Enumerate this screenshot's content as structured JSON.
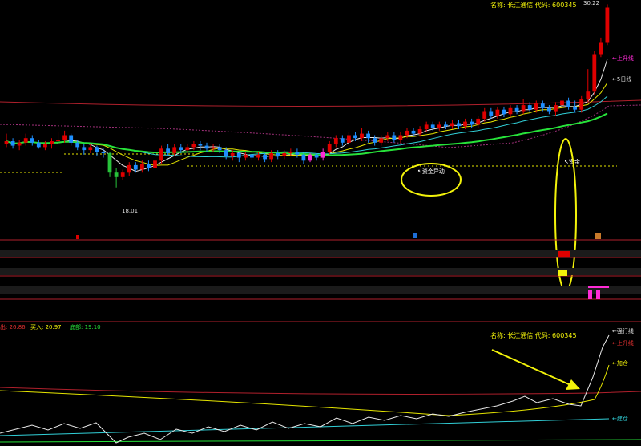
{
  "stock": {
    "name_label": "名称: 长江通信 代码: 600345",
    "name_label_lower": "名称: 长江通信 代码: 600345"
  },
  "colors": {
    "up": "#e00000",
    "down": "#1e8fff",
    "pink": "#ff2bd6",
    "green_line": "#27e33a",
    "yellow": "#e6e600",
    "red_line": "#b0202c",
    "cyan": "#31d0d8",
    "white": "#e8e8e8",
    "annot": "#f2f20a"
  },
  "chart_data": [
    {
      "type": "candlestick",
      "price_high_label": "30.22",
      "price_low_label": "18.01",
      "ylim": [
        16.5,
        30.4
      ],
      "x_count": 94,
      "candles": [
        [
          20.9,
          21.1,
          21.6,
          20.7
        ],
        [
          21.1,
          20.8,
          21.3,
          20.6
        ],
        [
          20.8,
          21.0,
          21.2,
          20.5
        ],
        [
          21.0,
          21.3,
          21.6,
          20.8
        ],
        [
          21.3,
          21.0,
          21.5,
          20.8
        ],
        [
          21.0,
          20.7,
          21.2,
          20.6
        ],
        [
          20.7,
          20.9,
          21.1,
          20.5
        ],
        [
          20.9,
          21.1,
          21.3,
          20.6
        ],
        [
          21.1,
          21.2,
          21.7,
          20.9
        ],
        [
          21.2,
          21.5,
          21.8,
          21.0
        ],
        [
          21.5,
          21.0,
          21.6,
          20.8
        ],
        [
          21.0,
          20.7,
          21.2,
          20.5
        ],
        [
          20.7,
          20.5,
          20.9,
          20.2
        ],
        [
          20.5,
          20.7,
          20.9,
          20.3
        ],
        [
          20.7,
          20.4,
          20.8,
          20.1
        ],
        [
          20.4,
          20.3,
          20.6,
          20.0
        ],
        [
          20.3,
          19.0,
          20.4,
          18.7
        ],
        [
          19.0,
          18.7,
          19.3,
          18.01
        ],
        [
          18.7,
          19.0,
          19.2,
          18.5
        ],
        [
          19.0,
          19.5,
          19.7,
          18.8
        ],
        [
          19.5,
          19.2,
          19.7,
          19.0
        ],
        [
          19.2,
          19.6,
          19.8,
          19.0
        ],
        [
          19.6,
          19.3,
          19.8,
          19.1
        ],
        [
          19.3,
          19.8,
          20.0,
          19.1
        ],
        [
          19.8,
          20.6,
          20.8,
          19.6
        ],
        [
          20.6,
          20.3,
          20.9,
          20.1
        ],
        [
          20.3,
          20.7,
          20.9,
          20.1
        ],
        [
          20.7,
          20.5,
          20.9,
          20.3
        ],
        [
          20.5,
          20.7,
          20.9,
          20.3
        ],
        [
          20.7,
          20.9,
          21.1,
          20.5
        ],
        [
          20.9,
          20.8,
          21.1,
          20.5
        ],
        [
          20.8,
          20.6,
          21.0,
          20.4
        ],
        [
          20.6,
          20.7,
          20.9,
          20.4
        ],
        [
          20.7,
          20.5,
          20.9,
          20.3
        ],
        [
          20.5,
          20.1,
          20.7,
          19.9
        ],
        [
          20.1,
          20.3,
          20.5,
          19.8
        ],
        [
          20.3,
          20.0,
          20.4,
          19.7
        ],
        [
          20.0,
          20.2,
          20.4,
          19.8
        ],
        [
          20.2,
          20.0,
          20.3,
          19.8
        ],
        [
          20.0,
          20.2,
          20.4,
          19.8
        ],
        [
          20.2,
          19.9,
          20.3,
          19.7
        ],
        [
          19.9,
          20.3,
          20.5,
          19.7
        ],
        [
          20.3,
          20.1,
          20.5,
          19.9
        ],
        [
          20.1,
          20.3,
          20.5,
          19.9
        ],
        [
          20.3,
          20.4,
          20.6,
          20.1
        ],
        [
          20.4,
          20.2,
          20.6,
          20.0
        ],
        [
          20.2,
          19.8,
          20.3,
          19.6
        ],
        [
          19.8,
          20.2,
          20.3,
          19.7
        ],
        [
          20.2,
          20.0,
          20.3,
          19.8
        ],
        [
          20.0,
          20.4,
          20.6,
          19.8
        ],
        [
          20.4,
          20.9,
          21.1,
          20.2
        ],
        [
          20.9,
          21.3,
          21.5,
          20.7
        ],
        [
          21.3,
          21.0,
          21.5,
          20.8
        ],
        [
          21.0,
          21.5,
          21.7,
          20.8
        ],
        [
          21.5,
          21.3,
          21.7,
          21.1
        ],
        [
          21.3,
          21.6,
          22.0,
          21.1
        ],
        [
          21.6,
          21.3,
          21.8,
          21.0
        ],
        [
          21.3,
          21.0,
          21.5,
          20.8
        ],
        [
          21.0,
          21.3,
          21.5,
          20.8
        ],
        [
          21.3,
          21.5,
          21.7,
          21.1
        ],
        [
          21.5,
          21.2,
          21.7,
          21.0
        ],
        [
          21.2,
          21.5,
          21.7,
          21.0
        ],
        [
          21.5,
          21.8,
          22.0,
          21.3
        ],
        [
          21.8,
          21.6,
          22.0,
          21.4
        ],
        [
          21.6,
          21.9,
          22.1,
          21.4
        ],
        [
          21.9,
          22.2,
          22.4,
          21.7
        ],
        [
          22.2,
          22.0,
          22.4,
          21.8
        ],
        [
          22.0,
          22.2,
          22.4,
          21.8
        ],
        [
          22.2,
          22.1,
          22.4,
          21.9
        ],
        [
          22.1,
          22.3,
          22.5,
          21.9
        ],
        [
          22.3,
          22.1,
          22.5,
          21.9
        ],
        [
          22.1,
          22.4,
          22.6,
          21.9
        ],
        [
          22.4,
          22.2,
          22.6,
          22.0
        ],
        [
          22.2,
          22.6,
          22.8,
          22.0
        ],
        [
          22.6,
          23.1,
          23.3,
          22.4
        ],
        [
          23.1,
          22.8,
          23.3,
          22.6
        ],
        [
          22.8,
          23.2,
          23.4,
          22.6
        ],
        [
          23.2,
          22.9,
          23.4,
          22.7
        ],
        [
          22.9,
          23.3,
          23.5,
          22.7
        ],
        [
          23.3,
          23.1,
          23.5,
          22.9
        ],
        [
          23.1,
          23.5,
          23.9,
          22.9
        ],
        [
          23.5,
          23.2,
          23.7,
          23.0
        ],
        [
          23.2,
          23.6,
          23.8,
          23.0
        ],
        [
          23.6,
          23.3,
          23.8,
          23.1
        ],
        [
          23.3,
          23.1,
          23.5,
          22.9
        ],
        [
          23.1,
          23.5,
          23.7,
          22.8
        ],
        [
          23.5,
          23.8,
          24.0,
          23.3
        ],
        [
          23.8,
          23.4,
          24.0,
          23.2
        ],
        [
          23.4,
          23.2,
          23.8,
          23.0
        ],
        [
          23.2,
          23.9,
          24.1,
          23.0
        ],
        [
          23.9,
          24.4,
          25.9,
          23.7
        ],
        [
          24.4,
          26.9,
          27.1,
          24.2
        ],
        [
          26.9,
          27.7,
          28.0,
          26.7
        ],
        [
          27.7,
          30.0,
          30.22,
          27.5
        ]
      ],
      "annotations": {
        "up_line_label": "←上升线",
        "ma5_label": "←5日线",
        "fund_label": "↖资金异动",
        "fund2_label": "↖资金"
      }
    },
    {
      "type": "line",
      "labels": {
        "sell_label": "出: 26.86",
        "buy_label": "买入: 20.97",
        "bottom_label": "底部: 19.10",
        "trend_label": "←强行线",
        "up_label": "←上升线",
        "add_label": "←加仓",
        "build_label": "←建仓"
      }
    }
  ]
}
